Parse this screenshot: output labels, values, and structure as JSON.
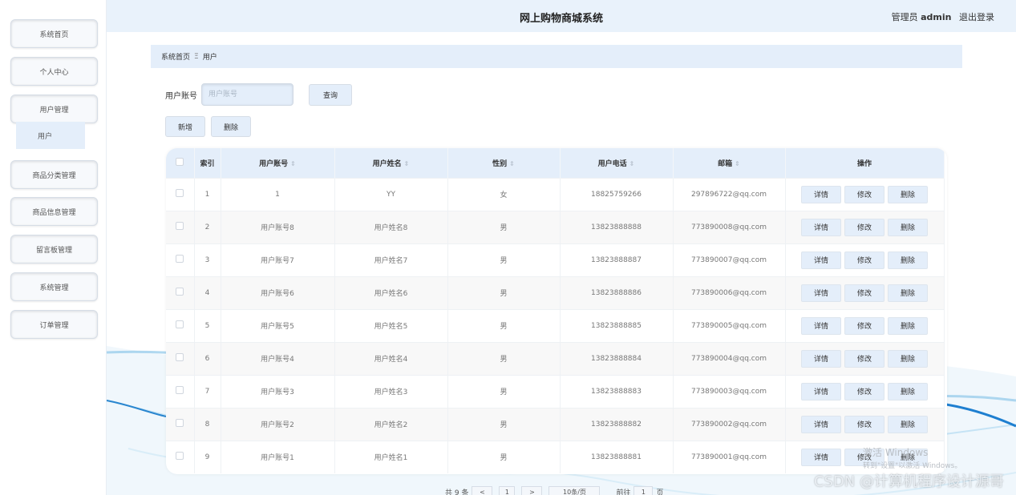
{
  "header": {
    "app_title": "网上购物商城系统",
    "role_label": "管理员",
    "username": "admin",
    "logout_label": "退出登录"
  },
  "sidebar": {
    "items": [
      {
        "label": "系统首页"
      },
      {
        "label": "个人中心"
      },
      {
        "label": "用户管理"
      },
      {
        "label": "商品分类管理"
      },
      {
        "label": "商品信息管理"
      },
      {
        "label": "留言板管理"
      },
      {
        "label": "系统管理"
      },
      {
        "label": "订单管理"
      }
    ],
    "sub_item": "用户"
  },
  "breadcrumb": {
    "home": "系统首页",
    "separator": "Ξ",
    "current": "用户"
  },
  "search": {
    "label": "用户账号",
    "placeholder": "用户账号",
    "query_label": "查询"
  },
  "actions": {
    "add_label": "新增",
    "delete_label": "删除"
  },
  "table": {
    "columns": [
      "索引",
      "用户账号",
      "用户姓名",
      "性别",
      "用户电话",
      "邮箱",
      "操作"
    ],
    "sort_glyph": "⇕",
    "op_labels": {
      "detail": "详情",
      "edit": "修改",
      "delete": "删除"
    },
    "rows": [
      {
        "index": "1",
        "account": "1",
        "name": "YY",
        "gender": "女",
        "phone": "18825759266",
        "email": "297896722@qq.com"
      },
      {
        "index": "2",
        "account": "用户账号8",
        "name": "用户姓名8",
        "gender": "男",
        "phone": "13823888888",
        "email": "773890008@qq.com"
      },
      {
        "index": "3",
        "account": "用户账号7",
        "name": "用户姓名7",
        "gender": "男",
        "phone": "13823888887",
        "email": "773890007@qq.com"
      },
      {
        "index": "4",
        "account": "用户账号6",
        "name": "用户姓名6",
        "gender": "男",
        "phone": "13823888886",
        "email": "773890006@qq.com"
      },
      {
        "index": "5",
        "account": "用户账号5",
        "name": "用户姓名5",
        "gender": "男",
        "phone": "13823888885",
        "email": "773890005@qq.com"
      },
      {
        "index": "6",
        "account": "用户账号4",
        "name": "用户姓名4",
        "gender": "男",
        "phone": "13823888884",
        "email": "773890004@qq.com"
      },
      {
        "index": "7",
        "account": "用户账号3",
        "name": "用户姓名3",
        "gender": "男",
        "phone": "13823888883",
        "email": "773890003@qq.com"
      },
      {
        "index": "8",
        "account": "用户账号2",
        "name": "用户姓名2",
        "gender": "男",
        "phone": "13823888882",
        "email": "773890002@qq.com"
      },
      {
        "index": "9",
        "account": "用户账号1",
        "name": "用户姓名1",
        "gender": "男",
        "phone": "13823888881",
        "email": "773890001@qq.com"
      }
    ]
  },
  "pagination": {
    "total_text": "共 9 条",
    "prev": "<",
    "page": "1",
    "next": ">",
    "page_size": "10条/页",
    "goto_label": "前往",
    "goto_value": "1",
    "page_suffix": "页"
  },
  "watermark": {
    "line1": "激活 Windows",
    "line2": "转到\"设置\"以激活 Windows。",
    "csdn": "CSDN @计算机程序设计源哥"
  },
  "colors": {
    "header_bg": "#e9f2fb",
    "accent_light": "#e4eefa",
    "table_row_alt": "#f8f8f8"
  }
}
